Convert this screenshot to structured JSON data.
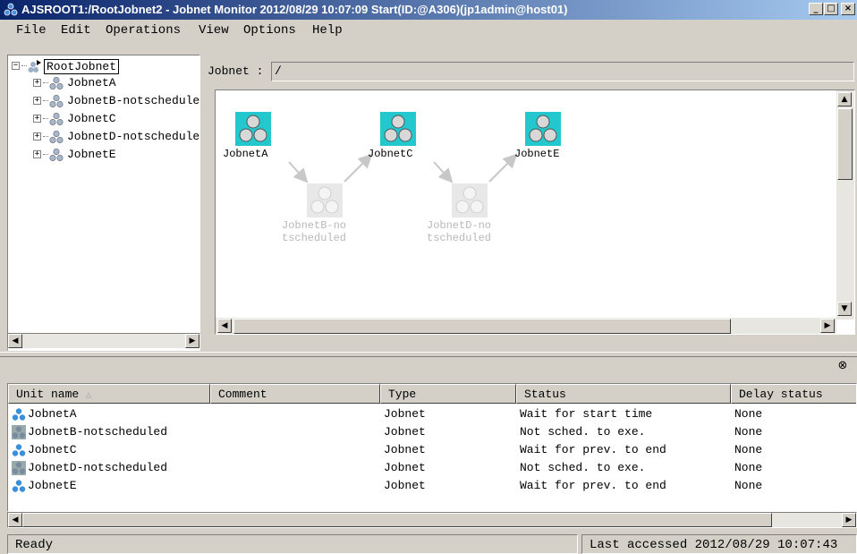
{
  "window": {
    "title": "AJSROOT1:/RootJobnet2 - Jobnet Monitor   2012/08/29 10:07:09 Start(ID:@A306)(jp1admin@host01)",
    "minimize_label": "_",
    "maximize_label": "□",
    "close_label": "×"
  },
  "menu": {
    "file": "File",
    "edit": "Edit",
    "operations": "Operations",
    "view": "View",
    "options": "Options",
    "help": "Help"
  },
  "tree": {
    "root": "RootJobnet",
    "items": [
      {
        "label": "JobnetA"
      },
      {
        "label": "JobnetB-notscheduled"
      },
      {
        "label": "JobnetC"
      },
      {
        "label": "JobnetD-notscheduled"
      },
      {
        "label": "JobnetE"
      }
    ]
  },
  "jobnet_path": {
    "label": "Jobnet :",
    "value": "/"
  },
  "map": {
    "nodes": [
      {
        "label": "JobnetA",
        "state": "active"
      },
      {
        "label": "JobnetB-no\ntscheduled",
        "state": "inactive"
      },
      {
        "label": "JobnetC",
        "state": "active"
      },
      {
        "label": "JobnetD-no\ntscheduled",
        "state": "inactive"
      },
      {
        "label": "JobnetE",
        "state": "active"
      }
    ]
  },
  "list": {
    "columns": {
      "unit_name": "Unit name",
      "unit_name_sort": "△",
      "comment": "Comment",
      "type": "Type",
      "status": "Status",
      "delay_status": "Delay status"
    },
    "rows": [
      {
        "unit_name": "JobnetA",
        "comment": "",
        "type": "Jobnet",
        "status": "Wait for start time",
        "delay_status": "None",
        "icon": "jobnet-icon"
      },
      {
        "unit_name": "JobnetB-notscheduled",
        "comment": "",
        "type": "Jobnet",
        "status": "Not sched. to exe.",
        "delay_status": "None",
        "icon": "jobnet-disabled-icon"
      },
      {
        "unit_name": "JobnetC",
        "comment": "",
        "type": "Jobnet",
        "status": "Wait for prev. to end",
        "delay_status": "None",
        "icon": "jobnet-icon"
      },
      {
        "unit_name": "JobnetD-notscheduled",
        "comment": "",
        "type": "Jobnet",
        "status": "Not sched. to exe.",
        "delay_status": "None",
        "icon": "jobnet-disabled-icon"
      },
      {
        "unit_name": "JobnetE",
        "comment": "",
        "type": "Jobnet",
        "status": "Wait for prev. to end",
        "delay_status": "None",
        "icon": "jobnet-icon"
      }
    ]
  },
  "statusbar": {
    "left": "Ready",
    "right": "Last accessed 2012/08/29 10:07:43"
  },
  "colors": {
    "title_start": "#0a246a",
    "title_end": "#a6caf0",
    "active_node": "#23c8cf",
    "inactive_node": "#e8e8e8"
  }
}
